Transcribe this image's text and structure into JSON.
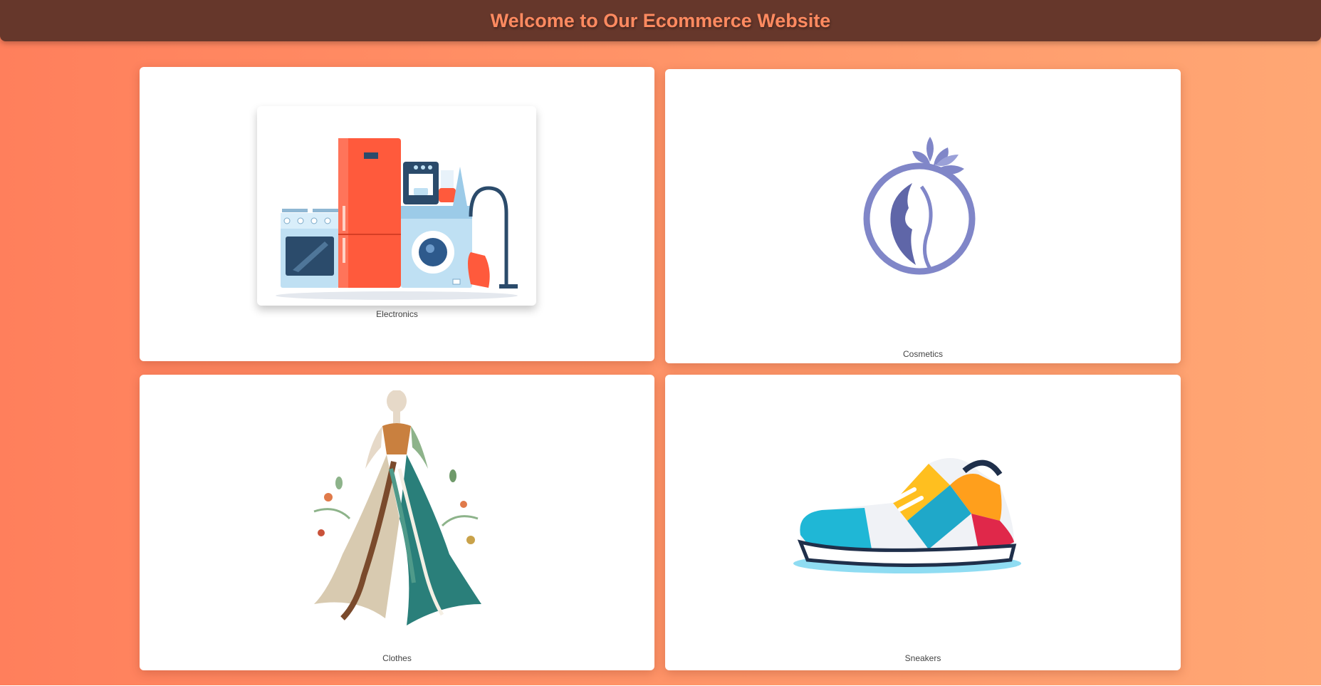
{
  "header": {
    "title": "Welcome to Our Ecommerce Website"
  },
  "categories": [
    {
      "label": "Electronics",
      "icon": "appliances-illustration"
    },
    {
      "label": "Cosmetics",
      "icon": "woman-face-logo"
    },
    {
      "label": "Clothes",
      "icon": "dress-illustration"
    },
    {
      "label": "Sneakers",
      "icon": "sneaker-illustration"
    }
  ],
  "colors": {
    "header_bg": "#66372b",
    "header_text": "#ff8a60",
    "page_bg_start": "#ff7f5c",
    "page_bg_end": "#ffa774",
    "card_bg": "#ffffff"
  }
}
